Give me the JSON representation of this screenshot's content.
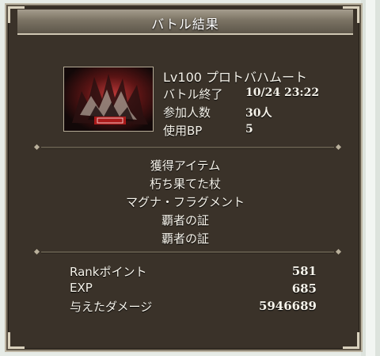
{
  "window": {
    "title": "バトル結果"
  },
  "battle": {
    "name": "Lv100 プロトバハムート",
    "rows": [
      {
        "label": "バトル終了",
        "value": "10/24 23:22"
      },
      {
        "label": "参加人数",
        "value": "30人"
      },
      {
        "label": "使用BP",
        "value": "5"
      }
    ]
  },
  "loot": {
    "heading": "獲得アイテム",
    "items": [
      "朽ち果てた杖",
      "マグナ・フラグメント",
      "覇者の証",
      "覇者の証"
    ]
  },
  "results": [
    {
      "label": "Rankポイント",
      "value": "581"
    },
    {
      "label": "EXP",
      "value": "685"
    },
    {
      "label": "与えたダメージ",
      "value": "5946689"
    }
  ],
  "colors": {
    "frame": "#3a3229",
    "text": "#f6f3ea",
    "accent": "#b01e1e"
  }
}
